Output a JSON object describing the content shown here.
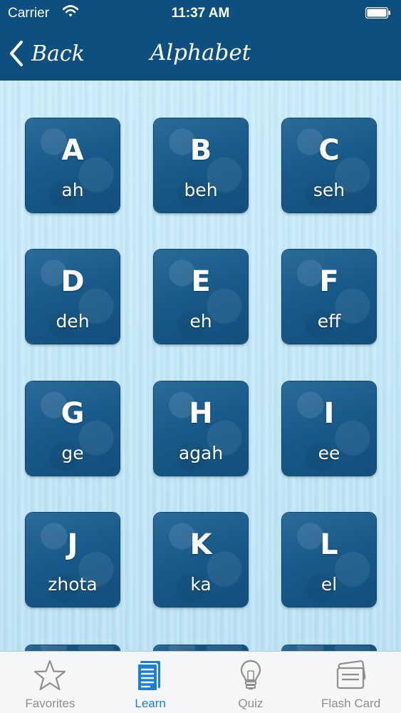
{
  "status_bar": {
    "carrier": "Carrier",
    "time": "11:37 AM",
    "icons": [
      "wifi-icon",
      "battery-icon"
    ]
  },
  "nav": {
    "back_label": "Back",
    "title": "Alphabet"
  },
  "letters": [
    {
      "letter": "A",
      "pron": "ah"
    },
    {
      "letter": "B",
      "pron": "beh"
    },
    {
      "letter": "C",
      "pron": "seh"
    },
    {
      "letter": "D",
      "pron": "deh"
    },
    {
      "letter": "E",
      "pron": "eh"
    },
    {
      "letter": "F",
      "pron": "eff"
    },
    {
      "letter": "G",
      "pron": "ge"
    },
    {
      "letter": "H",
      "pron": "agah"
    },
    {
      "letter": "I",
      "pron": "ee"
    },
    {
      "letter": "J",
      "pron": "zhota"
    },
    {
      "letter": "K",
      "pron": "ka"
    },
    {
      "letter": "L",
      "pron": "el"
    }
  ],
  "tabs": [
    {
      "label": "Favorites",
      "icon": "star-icon",
      "active": false
    },
    {
      "label": "Learn",
      "icon": "document-icon",
      "active": true
    },
    {
      "label": "Quiz",
      "icon": "lightbulb-icon",
      "active": false
    },
    {
      "label": "Flash Card",
      "icon": "flash-card-icon",
      "active": false
    }
  ],
  "colors": {
    "nav_background": "#0d4f7e",
    "tile": "#185a8a",
    "content_background": "#bfe3f3",
    "tab_active": "#1b7fd6",
    "tab_inactive": "#8e8e8e"
  }
}
